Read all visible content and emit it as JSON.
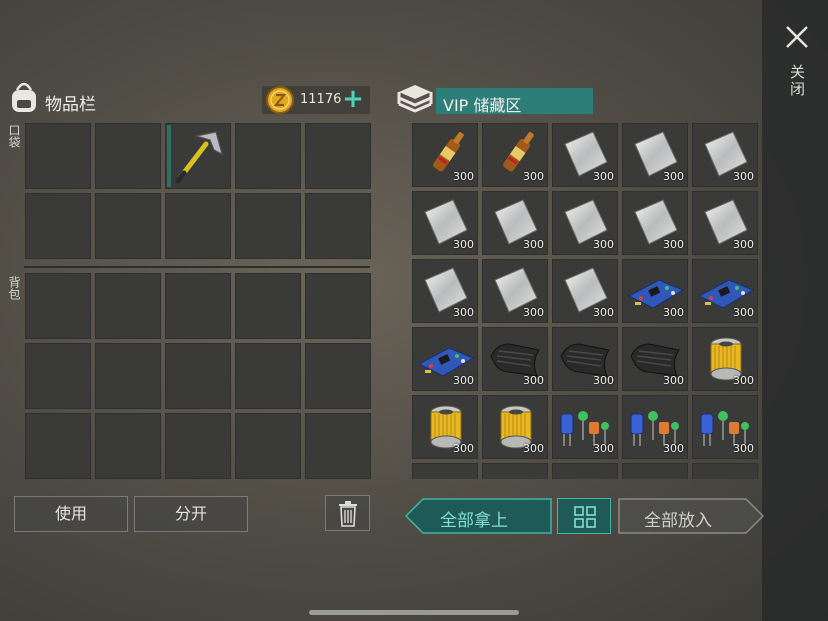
{
  "close_label": "关闭",
  "inventory": {
    "title": "物品栏",
    "coins": "11176",
    "pocket_label": "口袋",
    "backpack_label": "背包",
    "pocket_slots": [
      {
        "item": ""
      },
      {
        "item": ""
      },
      {
        "item": "hammer"
      },
      {
        "item": ""
      },
      {
        "item": ""
      },
      {
        "item": ""
      },
      {
        "item": ""
      },
      {
        "item": ""
      },
      {
        "item": ""
      },
      {
        "item": ""
      }
    ],
    "backpack_slot_count": 15
  },
  "buttons": {
    "use": "使用",
    "split": "分开",
    "take_all": "全部拿上",
    "put_all": "全部放入"
  },
  "vip": {
    "title": "VIP 储藏区",
    "items": [
      {
        "item": "ampoule",
        "count": "300"
      },
      {
        "item": "ampoule",
        "count": "300"
      },
      {
        "item": "metal-plate",
        "count": "300"
      },
      {
        "item": "metal-plate",
        "count": "300"
      },
      {
        "item": "metal-plate",
        "count": "300"
      },
      {
        "item": "metal-plate",
        "count": "300"
      },
      {
        "item": "metal-plate",
        "count": "300"
      },
      {
        "item": "metal-plate",
        "count": "300"
      },
      {
        "item": "metal-plate",
        "count": "300"
      },
      {
        "item": "metal-plate",
        "count": "300"
      },
      {
        "item": "metal-plate",
        "count": "300"
      },
      {
        "item": "metal-plate",
        "count": "300"
      },
      {
        "item": "metal-plate",
        "count": "300"
      },
      {
        "item": "circuit-board",
        "count": "300"
      },
      {
        "item": "circuit-board",
        "count": "300"
      },
      {
        "item": "circuit-board",
        "count": "300"
      },
      {
        "item": "carbon-fabric",
        "count": "300"
      },
      {
        "item": "carbon-fabric",
        "count": "300"
      },
      {
        "item": "carbon-fabric",
        "count": "300"
      },
      {
        "item": "filter",
        "count": "300"
      },
      {
        "item": "filter",
        "count": "300"
      },
      {
        "item": "filter",
        "count": "300"
      },
      {
        "item": "electronic-components",
        "count": "300"
      },
      {
        "item": "electronic-components",
        "count": "300"
      },
      {
        "item": "electronic-components",
        "count": "300"
      },
      {
        "item": "partial-item",
        "count": ""
      },
      {
        "item": "partial-item",
        "count": ""
      },
      {
        "item": "partial-item",
        "count": ""
      },
      {
        "item": "",
        "count": ""
      },
      {
        "item": "",
        "count": ""
      }
    ]
  },
  "colors": {
    "accent_teal": "#2d7d79",
    "teal_text": "#7fe0d0",
    "plus_green": "#4fd3b5",
    "coin_gold": "#e0a820"
  }
}
